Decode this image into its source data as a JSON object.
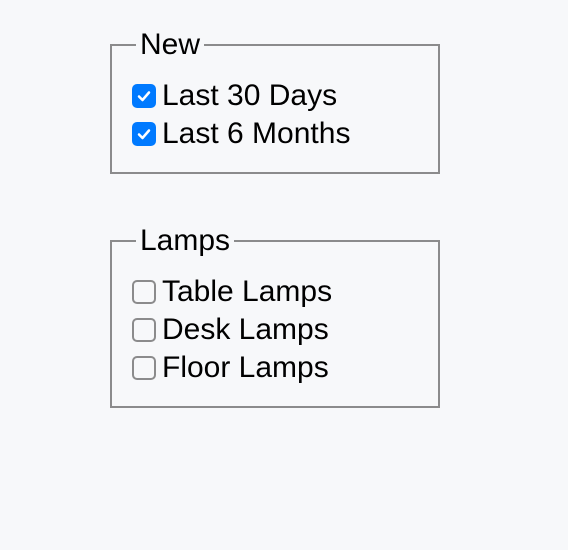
{
  "groups": [
    {
      "legend": "New",
      "items": [
        {
          "label": "Last 30 Days",
          "checked": true
        },
        {
          "label": "Last 6 Months",
          "checked": true
        }
      ]
    },
    {
      "legend": "Lamps",
      "items": [
        {
          "label": "Table Lamps",
          "checked": false
        },
        {
          "label": "Desk Lamps",
          "checked": false
        },
        {
          "label": "Floor Lamps",
          "checked": false
        }
      ]
    }
  ]
}
